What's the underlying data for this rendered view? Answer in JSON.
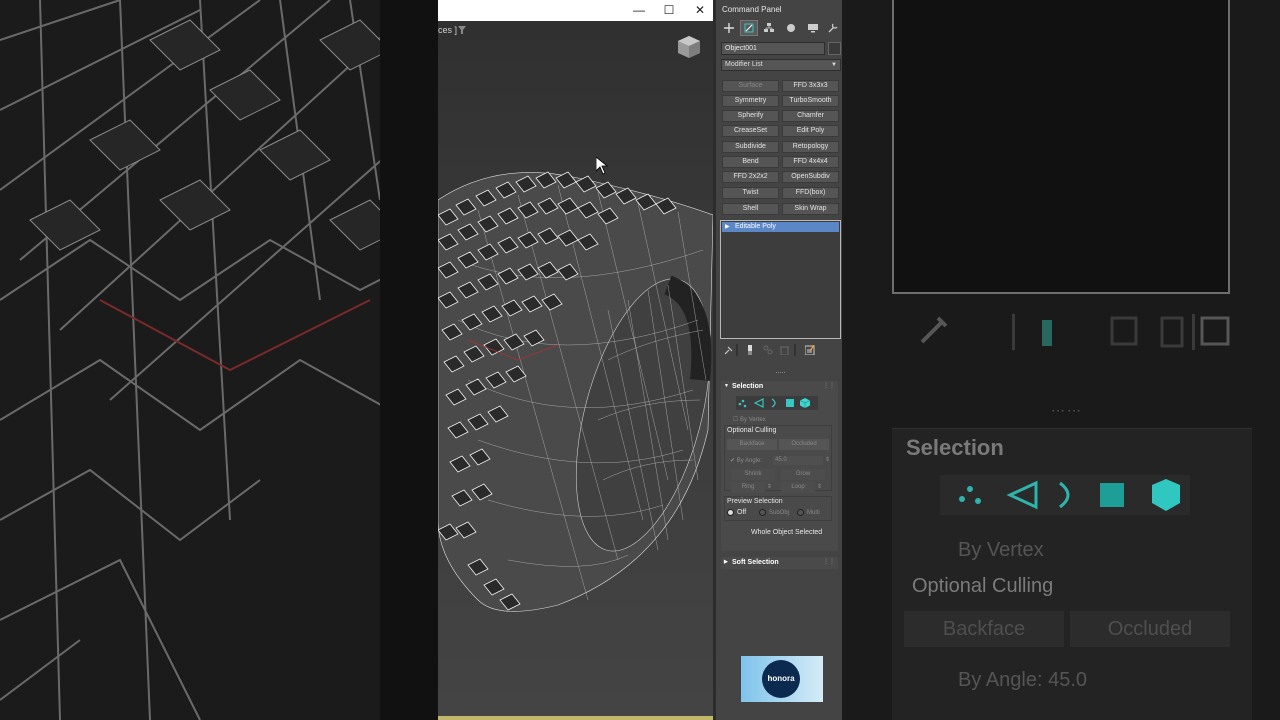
{
  "window": {
    "title": "",
    "controls": {
      "minimize": "—",
      "maximize": "☐",
      "close": "✕"
    }
  },
  "viewport": {
    "label": "ces ]",
    "filter_icon": "filter-icon",
    "viewcube_icon": "viewcube-icon"
  },
  "command_panel": {
    "title": "Command Panel",
    "tabs": [
      "create-icon",
      "modify-icon",
      "hierarchy-icon",
      "motion-icon",
      "display-icon",
      "utilities-icon"
    ],
    "object_name": "Object001",
    "modifier_list": "Modifier List",
    "modifier_buttons": [
      {
        "label": "Surface",
        "dim": true
      },
      {
        "label": "FFD 3x3x3",
        "dim": false
      },
      {
        "label": "Symmetry",
        "dim": false
      },
      {
        "label": "TurboSmooth",
        "dim": false
      },
      {
        "label": "Spherify",
        "dim": false
      },
      {
        "label": "Chamfer",
        "dim": false
      },
      {
        "label": "CreaseSet",
        "dim": false
      },
      {
        "label": "Edit Poly",
        "dim": false
      },
      {
        "label": "Subdivide",
        "dim": false
      },
      {
        "label": "Retopology",
        "dim": false
      },
      {
        "label": "Bend",
        "dim": false
      },
      {
        "label": "FFD 4x4x4",
        "dim": false
      },
      {
        "label": "FFD 2x2x2",
        "dim": false
      },
      {
        "label": "OpenSubdiv",
        "dim": false
      },
      {
        "label": "Twist",
        "dim": false
      },
      {
        "label": "FFD(box)",
        "dim": false
      },
      {
        "label": "Shell",
        "dim": false
      },
      {
        "label": "Skin Wrap",
        "dim": false
      }
    ],
    "stack_item": "Editable Poly",
    "selection": {
      "title": "Selection",
      "by_vertex": "By Vertex",
      "optional_culling": "Optional Culling",
      "backface": "Backface",
      "occluded": "Occluded",
      "by_angle_label": "By Angle:",
      "by_angle_value": "45.0",
      "shrink": "Shrink",
      "grow": "Grow",
      "ring": "Ring",
      "loop": "Loop",
      "preview_selection": "Preview Selection",
      "preview_off": "Off",
      "preview_subobj": "SubObj",
      "preview_multi": "Multi",
      "status": "Whole Object Selected"
    },
    "soft_selection": {
      "title": "Soft Selection"
    }
  },
  "logo": {
    "text": "honora"
  },
  "background": {
    "selection_title": "Selection",
    "by_vertex": "By Vertex",
    "optional_culling": "Optional Culling",
    "backface": "Backface",
    "occluded": "Occluded",
    "by_angle": "By Angle:",
    "by_angle_value": "45.0"
  },
  "colors": {
    "accent_teal": "#33c9c2",
    "stack_highlight": "#5b87c7",
    "panel_bg": "#444444"
  }
}
